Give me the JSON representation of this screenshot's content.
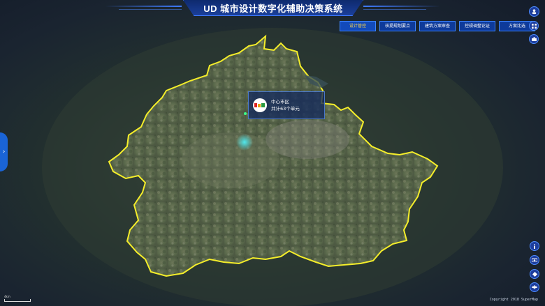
{
  "header": {
    "title": "UD 城市设计数字化辅助决策系统"
  },
  "toolbar": {
    "buttons": [
      {
        "label": "设计管控"
      },
      {
        "label": "核提规划要点"
      },
      {
        "label": "建筑方案审查"
      },
      {
        "label": "控规调整论证"
      },
      {
        "label": "方案比选"
      }
    ]
  },
  "tooltip": {
    "name": "中心市区",
    "count_text": "共计63个单元"
  },
  "footer": {
    "copyright": "Copyright 2018 SuperMap",
    "scale": "4km"
  },
  "colors": {
    "boundary": "#f5ee2a",
    "accent": "#3f7bff",
    "panel": "#0e3a9a"
  },
  "icons": [
    "user-avatar-icon",
    "grid-menu-icon",
    "briefcase-icon",
    "info-icon",
    "camera-icon",
    "compass-icon",
    "layers-icon",
    "chevron-right-icon"
  ]
}
